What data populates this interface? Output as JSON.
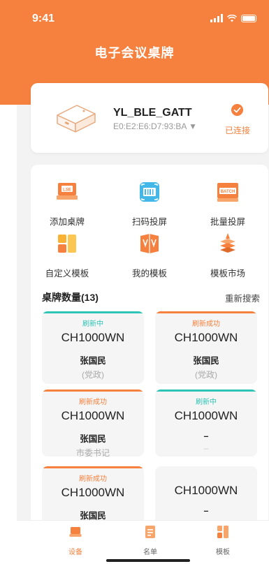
{
  "status_bar": {
    "time": "9:41"
  },
  "header": {
    "title": "电子会议桌牌"
  },
  "device": {
    "name": "YL_BLE_GATT",
    "mac": "E0:E2:E6:D7:93:BA ▼",
    "status": "已连接"
  },
  "actions": [
    {
      "label": "添加桌牌",
      "icon": "add-nameplate-icon",
      "badge": "LSE"
    },
    {
      "label": "扫码投屏",
      "icon": "scan-qr-icon"
    },
    {
      "label": "批量投屏",
      "icon": "batch-icon",
      "badge": "BATCH"
    },
    {
      "label": "自定义模板",
      "icon": "custom-template-icon"
    },
    {
      "label": "我的模板",
      "icon": "my-template-icon"
    },
    {
      "label": "模板市场",
      "icon": "template-market-icon"
    }
  ],
  "list": {
    "title": "桌牌数量(13)",
    "rescan": "重新搜索",
    "tiles": [
      {
        "status": "刷新中",
        "model": "CH1000WN",
        "person": "张国民",
        "dept": "(党政)"
      },
      {
        "status": "刷新成功",
        "model": "CH1000WN",
        "person": "张国民",
        "dept": "(党政)"
      },
      {
        "status": "刷新成功",
        "model": "CH1000WN",
        "person": "张国民",
        "dept": "市委书记"
      },
      {
        "status": "刷新中",
        "model": "CH1000WN",
        "person": "–",
        "dept": "–"
      },
      {
        "status": "刷新成功",
        "model": "CH1000WN",
        "person": "张国民",
        "dept": ""
      },
      {
        "status": "",
        "model": "CH1000WN",
        "person": "–",
        "dept": ""
      }
    ]
  },
  "tabs": [
    {
      "label": "设备",
      "icon": "device-tab-icon",
      "active": true
    },
    {
      "label": "名单",
      "icon": "list-tab-icon",
      "active": false
    },
    {
      "label": "模板",
      "icon": "template-tab-icon",
      "active": false
    }
  ],
  "colors": {
    "brand": "#f6813e",
    "refreshing": "#2ec4b6",
    "success": "#f6813e"
  }
}
